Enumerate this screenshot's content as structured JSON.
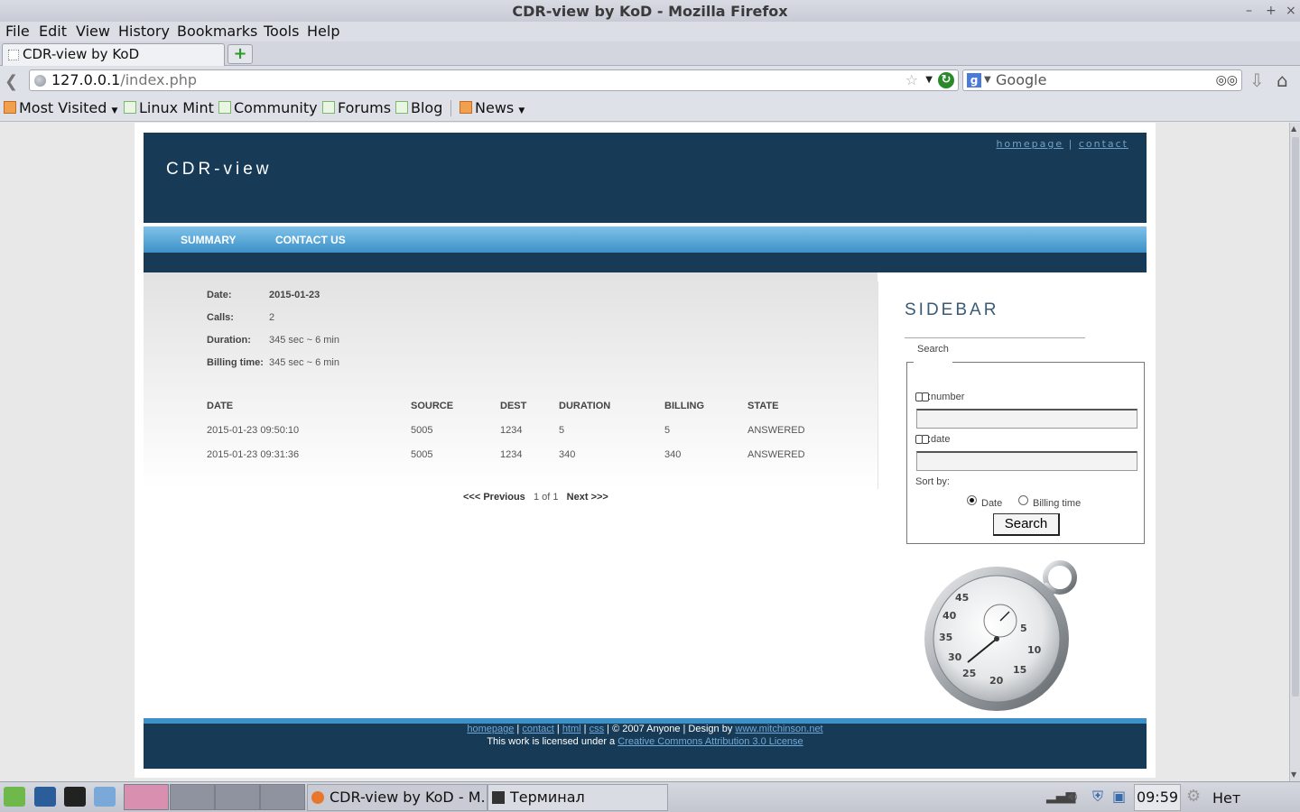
{
  "window": {
    "title": "CDR-view by KoD - Mozilla Firefox",
    "min": "–",
    "max": "+",
    "close": "×"
  },
  "menu": [
    "File",
    "Edit",
    "View",
    "History",
    "Bookmarks",
    "Tools",
    "Help"
  ],
  "tab": {
    "label": "CDR-view by KoD",
    "new_tab": "+"
  },
  "nav": {
    "url_host": "127.0.0.1",
    "url_path": "/index.php",
    "search_placeholder": "Google"
  },
  "bookmarks": [
    "Most Visited",
    "Linux Mint",
    "Community",
    "Forums",
    "Blog",
    "News"
  ],
  "site": {
    "title": "CDR-view",
    "top_links": [
      "homepage",
      "contact"
    ],
    "top_sep": "|",
    "menu": [
      "SUMMARY",
      "CONTACT US"
    ]
  },
  "summary": {
    "date_label": "Date:",
    "date": "2015-01-23",
    "calls_label": "Calls:",
    "calls": "2",
    "duration_label": "Duration:",
    "duration": "345 sec ~ 6 min",
    "billing_label": "Billing time:",
    "billing": "345 sec ~ 6 min"
  },
  "table": {
    "headers": [
      "DATE",
      "SOURCE",
      "DEST",
      "DURATION",
      "BILLING",
      "STATE"
    ],
    "rows": [
      [
        "2015-01-23 09:50:10",
        "5005",
        "1234",
        "5",
        "5",
        "ANSWERED"
      ],
      [
        "2015-01-23 09:31:36",
        "5005",
        "1234",
        "340",
        "340",
        "ANSWERED"
      ]
    ]
  },
  "pager": {
    "prev": "<<< Previous",
    "info": "1 of 1",
    "next": "Next >>>"
  },
  "sidebar": {
    "title": "SIDEBAR",
    "legend": "Search",
    "number_label": ":number",
    "date_label": ":date",
    "number_value": "",
    "date_value": "",
    "sort_label": "Sort by:",
    "sort_date": "Date",
    "sort_billing": "Billing time",
    "sort_selected": "Date",
    "button": "Search"
  },
  "footer": {
    "homepage": "homepage",
    "contact": "contact",
    "html": "html",
    "css": "css",
    "copyright": "© 2007 Anyone | Design by",
    "designer": "www.mitchinson.net",
    "license_text": "This work is licensed under a",
    "license_link": "Creative Commons Attribution 3.0 License"
  },
  "taskbar": {
    "tasks": [
      "CDR-view by KoD - M...",
      "Терминал"
    ],
    "clock": "09:59",
    "weather": "Нет данных"
  },
  "colors": {
    "header_bg": "#173a56",
    "menu_bg": "#3d91c7",
    "link": "#6fa2c8"
  }
}
